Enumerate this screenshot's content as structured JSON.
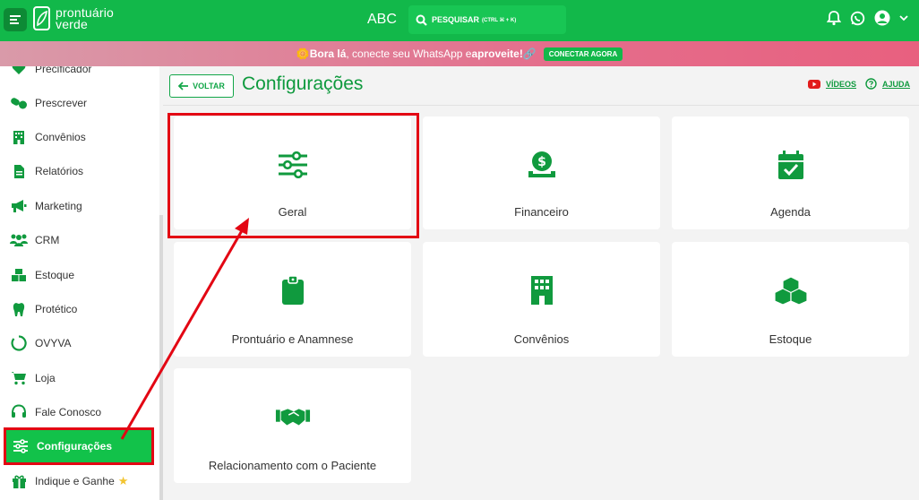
{
  "topbar": {
    "brand_line1": "prontuário",
    "brand_line2": "verde",
    "account_name": "ABC",
    "search_label": "PESQUISAR",
    "search_shortcut": "(CTRL ⌘ + K)"
  },
  "promo": {
    "emoji": "🌼",
    "strong1": "Bora lá",
    "middle": ", conecte seu WhatsApp e ",
    "strong2": "aproveite!",
    "tail": " 🔗",
    "button": "CONECTAR AGORA"
  },
  "sidebar": {
    "items": [
      {
        "label": "Precificador",
        "icon": "heart-icon"
      },
      {
        "label": "Prescrever",
        "icon": "pills-icon"
      },
      {
        "label": "Convênios",
        "icon": "building-icon"
      },
      {
        "label": "Relatórios",
        "icon": "file-icon"
      },
      {
        "label": "Marketing",
        "icon": "megaphone-icon"
      },
      {
        "label": "CRM",
        "icon": "users-icon"
      },
      {
        "label": "Estoque",
        "icon": "boxes-icon"
      },
      {
        "label": "Protético",
        "icon": "tooth-icon"
      },
      {
        "label": "OVYVA",
        "icon": "ring-icon"
      },
      {
        "label": "Loja",
        "icon": "cart-icon"
      },
      {
        "label": "Fale Conosco",
        "icon": "headset-icon"
      },
      {
        "label": "Configurações",
        "icon": "sliders-icon"
      },
      {
        "label": "Indique e Ganhe",
        "icon": "gift-icon"
      }
    ]
  },
  "header": {
    "back_label": "VOLTAR",
    "title": "Configurações",
    "videos_label": "VÍDEOS",
    "help_label": "AJUDA"
  },
  "cards": [
    {
      "label": "Geral",
      "icon": "sliders-icon"
    },
    {
      "label": "Financeiro",
      "icon": "money-hand-icon"
    },
    {
      "label": "Agenda",
      "icon": "calendar-check-icon"
    },
    {
      "label": "Prontuário e Anamnese",
      "icon": "clipboard-icon"
    },
    {
      "label": "Convênios",
      "icon": "building-icon"
    },
    {
      "label": "Estoque",
      "icon": "boxes-icon"
    },
    {
      "label": "Relacionamento com o Paciente",
      "icon": "handshake-icon"
    }
  ],
  "colors": {
    "brand_green": "#12b84a",
    "text_green": "#0f9a3e",
    "highlight_red": "#e30613"
  }
}
